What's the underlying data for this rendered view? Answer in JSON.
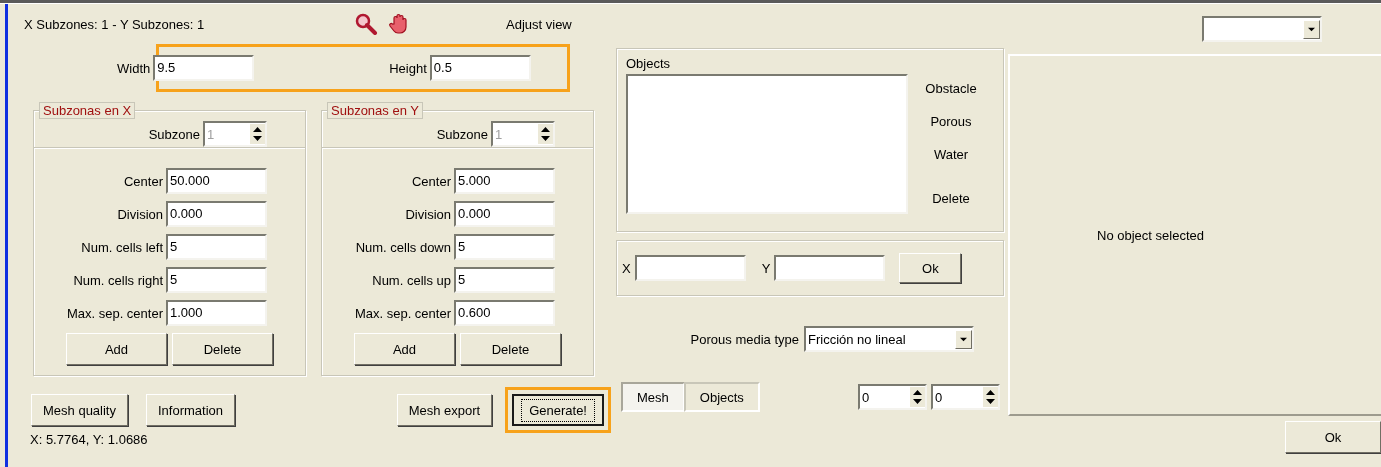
{
  "header": {
    "subzone_summary": "X Subzones: 1 - Y Subzones: 1",
    "adjust_view": "Adjust view"
  },
  "dimensions": {
    "highlighted": true,
    "fields": [
      {
        "label": "Width",
        "value": "9.5"
      },
      {
        "label": "Height",
        "value": "0.5"
      }
    ]
  },
  "subzone_groups": [
    {
      "title": "Subzonas en X",
      "subzone_label": "Subzone",
      "subzone_value": "1",
      "subzone_disabled": true,
      "fields": [
        {
          "label": "Center",
          "value": "50.000"
        },
        {
          "label": "Division",
          "value": "0.000"
        },
        {
          "label": "Num. cells left",
          "value": "5"
        },
        {
          "label": "Num. cells right",
          "value": "5"
        },
        {
          "label": "Max. sep. center",
          "value": "1.000"
        }
      ],
      "buttons": [
        "Add",
        "Delete"
      ]
    },
    {
      "title": "Subzonas en Y",
      "subzone_label": "Subzone",
      "subzone_value": "1",
      "subzone_disabled": true,
      "fields": [
        {
          "label": "Center",
          "value": "5.000"
        },
        {
          "label": "Division",
          "value": "0.000"
        },
        {
          "label": "Num. cells down",
          "value": "5"
        },
        {
          "label": "Num. cells up",
          "value": "5"
        },
        {
          "label": "Max. sep. center",
          "value": "0.600"
        }
      ],
      "buttons": [
        "Add",
        "Delete"
      ]
    }
  ],
  "left_actions": [
    {
      "label": "Mesh quality",
      "highlighted": false,
      "focused": false
    },
    {
      "label": "Information",
      "highlighted": false,
      "focused": false
    }
  ],
  "right_actions": [
    {
      "label": "Mesh export",
      "highlighted": false,
      "focused": false
    },
    {
      "label": "Generate!",
      "highlighted": true,
      "focused": true
    }
  ],
  "status": "X: 5.7764, Y: 1.0686",
  "objects": {
    "title": "Objects",
    "types": [
      "Obstacle",
      "Porous",
      "Water",
      "Delete"
    ]
  },
  "coordinates": {
    "fields": [
      {
        "label": "X"
      },
      {
        "label": "Y"
      }
    ],
    "ok": "Ok"
  },
  "porous_media": {
    "label": "Porous media type",
    "value": "Fricción no lineal"
  },
  "tabs": [
    {
      "label": "Mesh",
      "selected": true
    },
    {
      "label": "Objects",
      "selected": false
    }
  ],
  "spinners": [
    "0",
    "0"
  ],
  "details": {
    "message": "No object selected"
  },
  "ok_button": "Ok"
}
